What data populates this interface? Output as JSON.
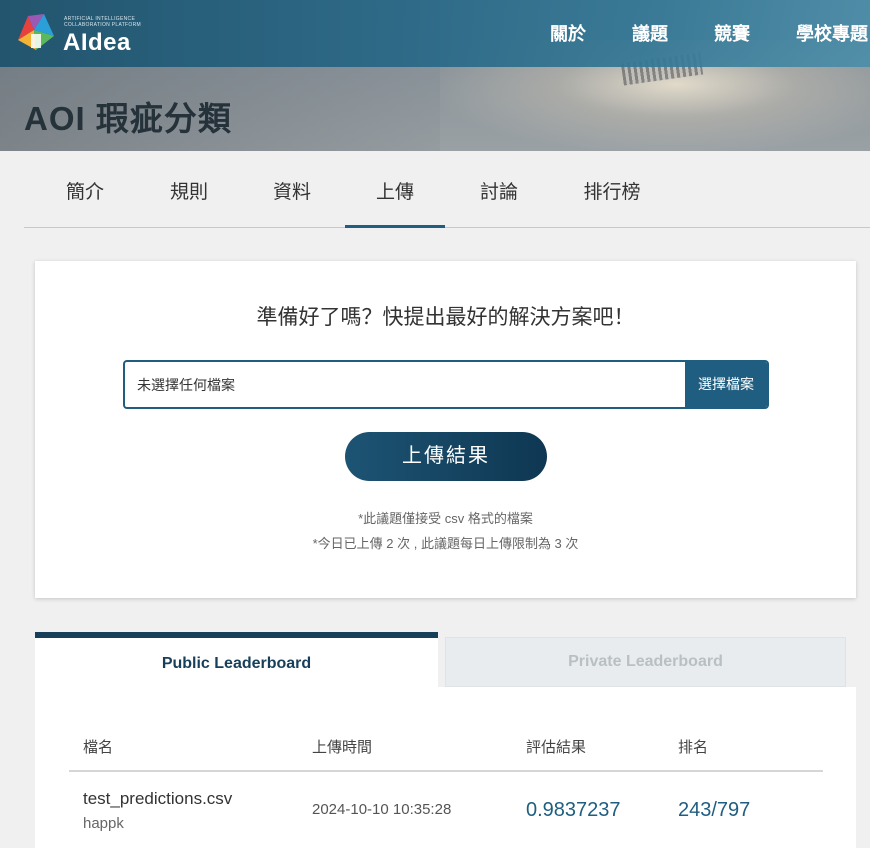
{
  "header": {
    "logo_subtitle": "ARTIFICIAL INTELLIGENCE\nCOLLABORATION PLATFORM",
    "logo_text": "AIdea",
    "nav": [
      "關於",
      "議題",
      "競賽",
      "學校專題"
    ]
  },
  "page": {
    "title": "AOI 瑕疵分類"
  },
  "tabs": {
    "items": [
      "簡介",
      "規則",
      "資料",
      "上傳",
      "討論",
      "排行榜"
    ],
    "active": "上傳"
  },
  "upload": {
    "heading": "準備好了嗎？快提出最好的解決方案吧！",
    "file_placeholder": "未選擇任何檔案",
    "choose_button": "選擇檔案",
    "submit_button": "上傳結果",
    "note_format": "*此議題僅接受 csv 格式的檔案",
    "note_limit": "*今日已上傳 2 次 , 此議題每日上傳限制為 3 次"
  },
  "leaderboard": {
    "tab_public": "Public Leaderboard",
    "tab_private": "Private Leaderboard",
    "active_tab": "Public Leaderboard",
    "columns": [
      "檔名",
      "上傳時間",
      "評估結果",
      "排名"
    ],
    "rows": [
      {
        "file": "test_predictions.csv",
        "user": "happk",
        "time": "2024-10-10 10:35:28",
        "score": "0.9837237",
        "rank": "243/797"
      }
    ]
  },
  "colors": {
    "brand": "#1f5e80",
    "header_bar": "#2c6784",
    "dark_button": "#0e3752"
  }
}
